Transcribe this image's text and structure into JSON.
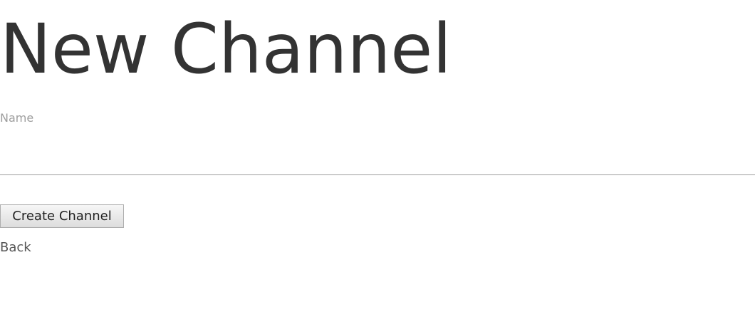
{
  "page": {
    "title": "New Channel"
  },
  "form": {
    "name_label": "Name",
    "name_value": "",
    "submit_label": "Create Channel"
  },
  "nav": {
    "back_label": "Back"
  }
}
